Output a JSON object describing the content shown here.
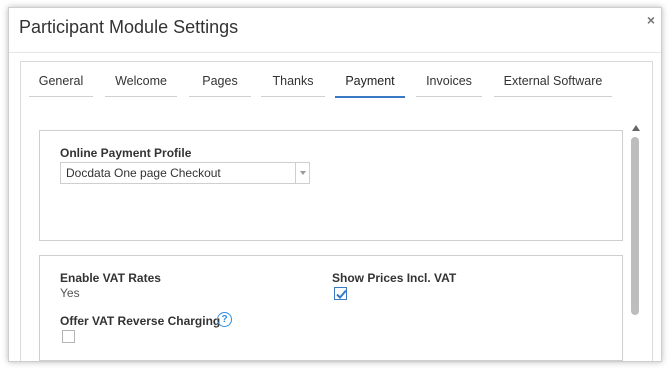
{
  "dialog": {
    "title": "Participant Module Settings",
    "close_icon": "×"
  },
  "tabs": [
    {
      "label": "General"
    },
    {
      "label": "Welcome"
    },
    {
      "label": "Pages"
    },
    {
      "label": "Thanks"
    },
    {
      "label": "Payment",
      "active": true
    },
    {
      "label": "Invoices"
    },
    {
      "label": "External Software"
    }
  ],
  "payment_profile": {
    "label": "Online Payment Profile",
    "selected": "Docdata One page Checkout"
  },
  "vat": {
    "enable_label": "Enable VAT Rates",
    "enable_value": "Yes",
    "show_prices_label": "Show Prices Incl. VAT",
    "show_prices_checked": true,
    "reverse_label": "Offer VAT Reverse Charging",
    "reverse_checked": false,
    "help_icon": "?"
  },
  "colors": {
    "accent": "#3b78c3",
    "help": "#2f8ee0"
  }
}
